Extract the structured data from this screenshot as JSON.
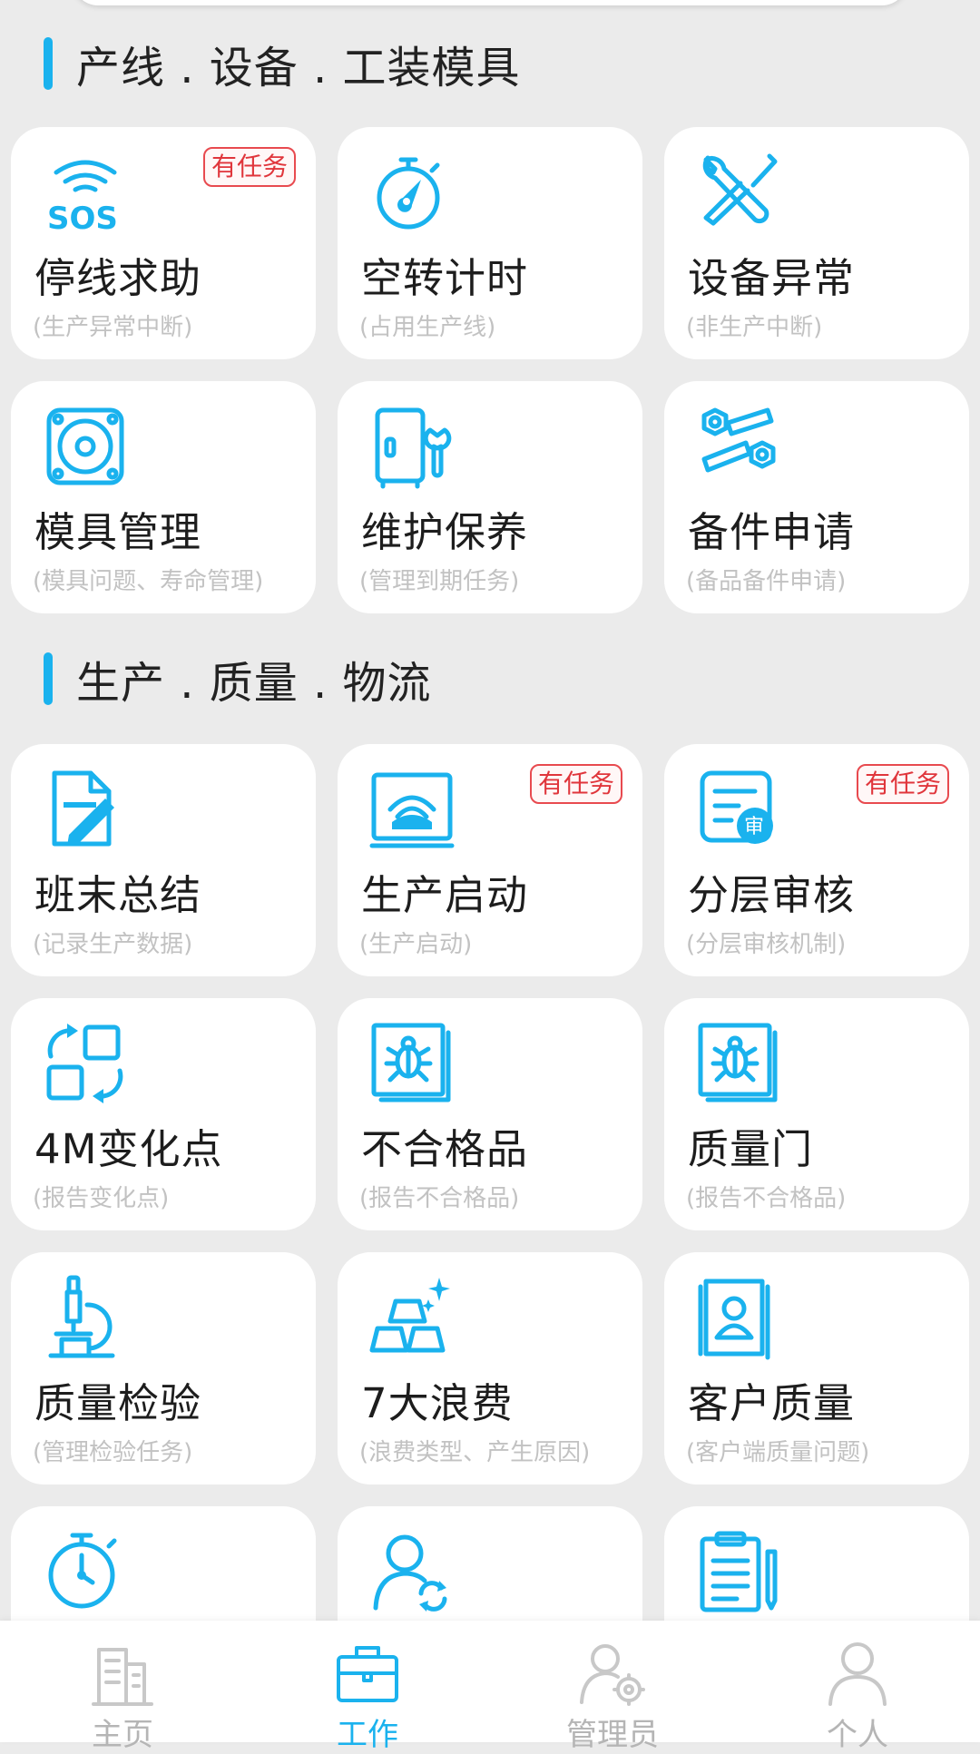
{
  "accent_color": "#1ab2ee",
  "badge_color": "#e0363c",
  "sections": [
    {
      "title": "产线 . 设备 . 工装模具",
      "items": [
        {
          "title": "停线求助",
          "subtitle": "(生产异常中断)",
          "badge": "有任务",
          "icon": "sos-icon"
        },
        {
          "title": "空转计时",
          "subtitle": "(占用生产线)",
          "badge": "",
          "icon": "stopwatch-icon"
        },
        {
          "title": "设备异常",
          "subtitle": "(非生产中断)",
          "badge": "",
          "icon": "tools-icon"
        },
        {
          "title": "模具管理",
          "subtitle": "(模具问题、寿命管理)",
          "badge": "",
          "icon": "mold-icon"
        },
        {
          "title": "维护保养",
          "subtitle": "(管理到期任务)",
          "badge": "",
          "icon": "cabinet-wrench-icon"
        },
        {
          "title": "备件申请",
          "subtitle": "(备品备件申请)",
          "badge": "",
          "icon": "spare-parts-icon"
        }
      ]
    },
    {
      "title": "生产 . 质量 . 物流",
      "items": [
        {
          "title": "班末总结",
          "subtitle": "(记录生产数据)",
          "badge": "",
          "icon": "document-pen-icon"
        },
        {
          "title": "生产启动",
          "subtitle": "(生产启动)",
          "badge": "有任务",
          "icon": "monitor-signal-icon"
        },
        {
          "title": "分层审核",
          "subtitle": "(分层审核机制)",
          "badge": "有任务",
          "icon": "audit-document-icon"
        },
        {
          "title": "4M变化点",
          "subtitle": "(报告变化点)",
          "badge": "",
          "icon": "swap-squares-icon"
        },
        {
          "title": "不合格品",
          "subtitle": "(报告不合格品)",
          "badge": "",
          "icon": "bug-frame-icon"
        },
        {
          "title": "质量门",
          "subtitle": "(报告不合格品)",
          "badge": "",
          "icon": "bug-frame-icon"
        },
        {
          "title": "质量检验",
          "subtitle": "(管理检验任务)",
          "badge": "",
          "icon": "microscope-icon"
        },
        {
          "title": "7大浪费",
          "subtitle": "(浪费类型、产生原因)",
          "badge": "",
          "icon": "gold-bars-icon"
        },
        {
          "title": "客户质量",
          "subtitle": "(客户端质量问题)",
          "badge": "",
          "icon": "customer-card-icon"
        },
        {
          "title": "",
          "subtitle": "",
          "badge": "",
          "icon": "stopwatch-icon"
        },
        {
          "title": "",
          "subtitle": "",
          "badge": "",
          "icon": "person-sync-icon"
        },
        {
          "title": "",
          "subtitle": "",
          "badge": "",
          "icon": "clipboard-pen-icon"
        }
      ]
    }
  ],
  "tabbar": [
    {
      "label": "主页",
      "icon": "building-icon",
      "active": false
    },
    {
      "label": "工作",
      "icon": "briefcase-icon",
      "active": true
    },
    {
      "label": "管理员",
      "icon": "admin-gear-icon",
      "active": false
    },
    {
      "label": "个人",
      "icon": "person-icon",
      "active": false
    }
  ]
}
